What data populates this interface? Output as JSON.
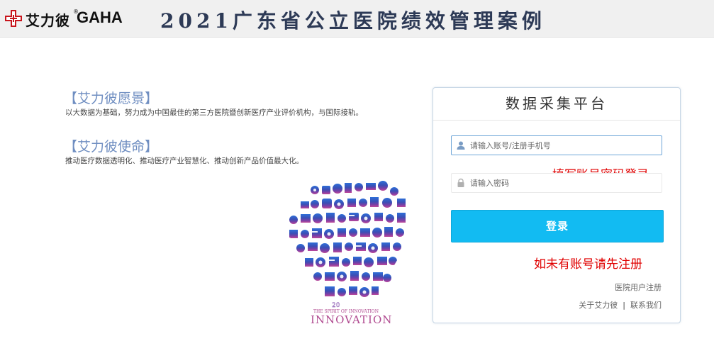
{
  "header": {
    "logo_cn": "艾力彼",
    "logo_reg": "®",
    "logo_en": "GAHA",
    "title": "2021广东省公立医院绩效管理案例"
  },
  "intro": {
    "vision_title": "【艾力彼愿景】",
    "vision_text": "以大数据为基础，努力成为中国最佳的第三方医院暨创新医疗产业评价机构，与国际接轨。",
    "mission_title": "【艾力彼使命】",
    "mission_text": "推动医疗数据透明化、推动医疗产业智慧化、推动创新产品价值最大化。",
    "illustration_caption_top": "THE SPIRIT OF INNOVATION",
    "illustration_caption": "INNOVATION",
    "illustration_date": "20"
  },
  "login": {
    "card_title": "数据采集平台",
    "username_placeholder": "请输入账号/注册手机号",
    "password_placeholder": "请输入密码",
    "login_button": "登录",
    "annotation_login": "填写账号密码登录",
    "annotation_register": "如未有账号请先注册",
    "register_link": "医院用户注册",
    "about_link": "关于艾力彼",
    "separator": "|",
    "contact_link": "联系我们"
  },
  "colors": {
    "accent": "#12bbf2",
    "heading_blue": "#6f8ec1",
    "annotation_red": "#e00000",
    "title_navy": "#2d3a56"
  }
}
